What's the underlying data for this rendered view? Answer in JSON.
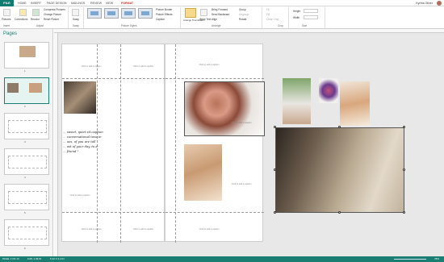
{
  "tabs": [
    "HOME",
    "INSERT",
    "PAGE DESIGN",
    "MAILINGS",
    "REVIEW",
    "VIEW",
    "FORMAT"
  ],
  "file_tab": "FILE",
  "user_name": "Kyrtha Oliver",
  "ribbon": {
    "insert_label": "Pictures",
    "corrections_label": "Corrections",
    "recolor_label": "Recolor",
    "compress_label": "Compress Pictures",
    "change_label": "Change Picture",
    "reset_label": "Reset Picture",
    "swap_label": "Swap",
    "border_label": "Picture Border",
    "effects_label": "Picture Effects",
    "caption_label": "Caption",
    "arrange_thumb_label": "Arrange Thumbnails",
    "wrap_label": "Wrap Text",
    "forward_label": "Bring Forward",
    "backward_label": "Send Backward",
    "align_label": "Align",
    "group_label": "Group",
    "ungroup_label": "Ungroup",
    "rotate_label": "Rotate",
    "fit_label": "Fit",
    "fill_label": "Fill",
    "clear_crop_label": "Clear Crop",
    "height_label": "Height",
    "width_label": "Width",
    "groups": [
      "Insert",
      "Adjust",
      "Swap",
      "Picture Styles",
      "Arrange",
      "Crop",
      "Size"
    ]
  },
  "sidebar": {
    "title": "Pages",
    "page_numbers": [
      "1",
      "2",
      "3",
      "4",
      "5",
      "6",
      "7"
    ]
  },
  "placeholders": {
    "text": "Click to add a caption"
  },
  "poem": "... sweet, quiet sit caption\n... conversational tone in\n... oes, of you are tall\n... ost of your day, to a\n... friend.\"",
  "status": {
    "page": "PAGE: 2 OF 13",
    "position": "6.08, 1.39 IN",
    "size": "5.42 X 3.4 IN",
    "zoom": "78%"
  }
}
